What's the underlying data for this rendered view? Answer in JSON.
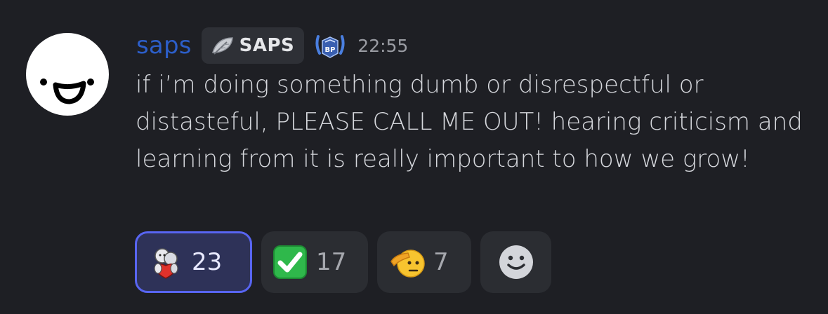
{
  "message": {
    "author": "saps",
    "tag_label": "SAPS",
    "timestamp": "22:55",
    "text": "if i’m doing something dumb or disrespectful or distasteful, PLEASE CALL ME OUT! hearing criticism and learning from it is really important to how we grow!",
    "colors": {
      "author": "#2c5ec9",
      "background": "#1e1f24",
      "active_reaction_border": "#5865f2"
    },
    "icons": {
      "tag": "feather-icon",
      "badge": "bp-badge-icon",
      "add_reaction": "add-reaction-smiley-icon"
    }
  },
  "reactions": [
    {
      "emoji": "hug-sticker-emoji",
      "count": "23",
      "active": true
    },
    {
      "emoji": "white-check-mark-emoji",
      "count": "17",
      "active": false
    },
    {
      "emoji": "saluting-face-emoji",
      "count": "7",
      "active": false
    }
  ]
}
